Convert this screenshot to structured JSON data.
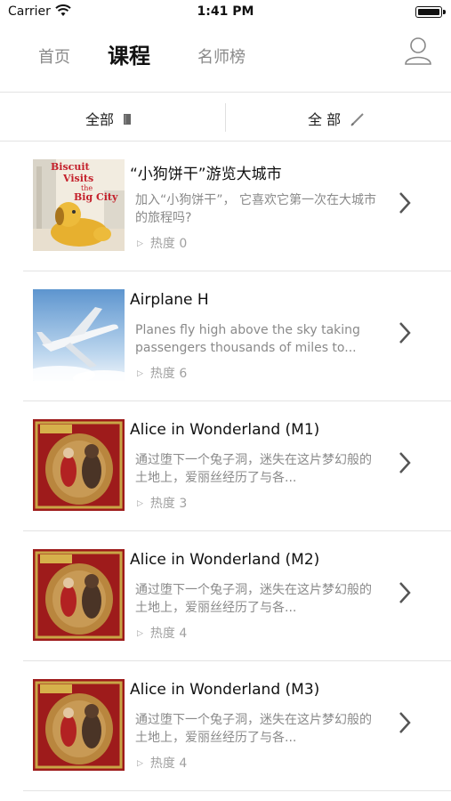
{
  "status": {
    "carrier": "Carrier",
    "time": "1:41 PM"
  },
  "nav": {
    "tabs": [
      {
        "label": "首页",
        "active": false
      },
      {
        "label": "课程",
        "active": true
      },
      {
        "label": "名师榜",
        "active": false
      }
    ],
    "profile_icon": "user-icon"
  },
  "filters": [
    {
      "label": "全部",
      "icon": "book-icon"
    },
    {
      "label": "全 部",
      "icon": "pencil-icon"
    }
  ],
  "courses": [
    {
      "title": "“小狗饼干”游览大城市",
      "description": "加入“小狗饼干”， 它喜欢它第一次在大城市的旅程吗?",
      "heat_label": "热度 0",
      "cover_text": [
        "Biscuit",
        "Visits",
        "the",
        "Big City"
      ]
    },
    {
      "title": "Airplane H",
      "description": "Planes fly high above the sky taking passengers thousands of miles to...",
      "heat_label": "热度 6"
    },
    {
      "title": "Alice in Wonderland (M1)",
      "description": "通过堕下一个兔子洞，迷失在这片梦幻般的土地上，爱丽丝经历了与各...",
      "heat_label": "热度 3"
    },
    {
      "title": "Alice in Wonderland  (M2)",
      "description": "通过堕下一个兔子洞，迷失在这片梦幻般的土地上，爱丽丝经历了与各...",
      "heat_label": "热度 4"
    },
    {
      "title": "Alice in Wonderland (M3)",
      "description": "通过堕下一个兔子洞，迷失在这片梦幻般的土地上，爱丽丝经历了与各...",
      "heat_label": "热度 4"
    }
  ]
}
